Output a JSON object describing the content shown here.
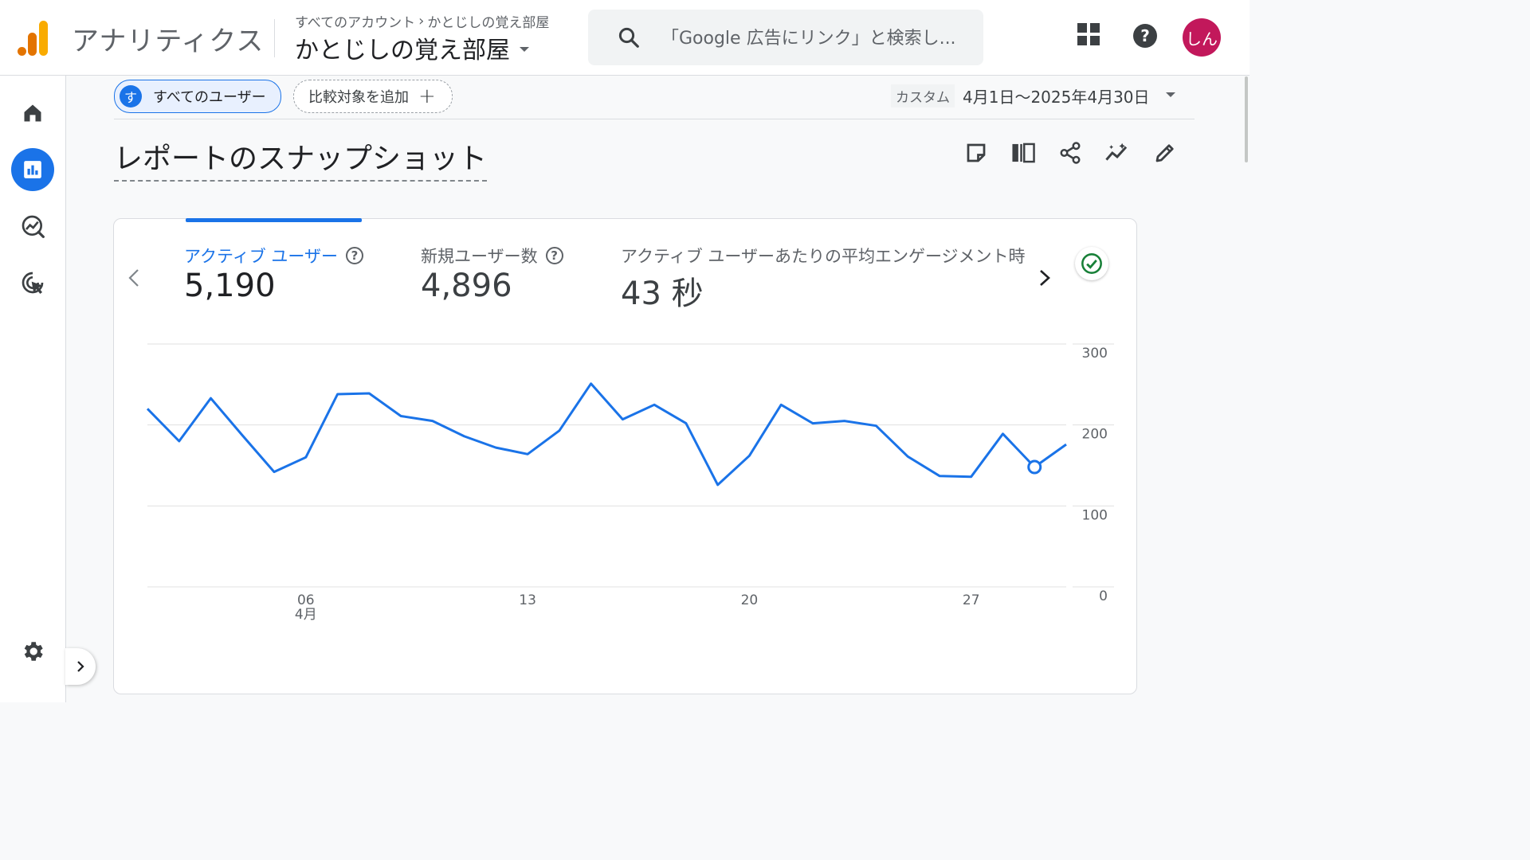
{
  "app": {
    "name": "アナリティクス"
  },
  "header": {
    "breadcrumb_account": "すべてのアカウント",
    "breadcrumb_sep": "›",
    "breadcrumb_property": "かとじしの覚え部屋",
    "property_name": "かとじしの覚え部屋",
    "search_placeholder": "「Google 広告にリンク」と検索し...",
    "avatar_text": "しん"
  },
  "segment": {
    "chip_badge": "す",
    "chip_label": "すべてのユーザー",
    "compare_label": "比較対象を追加",
    "compare_plus": "+"
  },
  "date": {
    "tag": "カスタム",
    "range": "4月1日～2025年4月30日"
  },
  "page": {
    "title": "レポートのスナップショット"
  },
  "metrics": [
    {
      "label": "アクティブ ユーザー",
      "value": "5,190"
    },
    {
      "label": "新規ユーザー数",
      "value": "4,896"
    },
    {
      "label": "アクティブ ユーザーあたりの平均エンゲージメント時",
      "value": "43 秒"
    }
  ],
  "colors": {
    "accent": "#1a73e8",
    "avatar": "#c2185b",
    "success": "#188038"
  },
  "chart_data": {
    "type": "line",
    "series": [
      {
        "x": [
          1,
          2,
          3,
          4,
          5,
          6,
          7,
          8,
          9,
          10,
          11,
          12,
          13,
          14,
          15,
          16,
          17,
          18,
          19,
          20,
          21,
          22,
          23,
          24,
          25,
          26,
          27,
          28,
          29,
          30
        ],
        "values": [
          220,
          180,
          233,
          187,
          142,
          160,
          238,
          239,
          211,
          205,
          186,
          172,
          164,
          193,
          251,
          207,
          225,
          202,
          126,
          162,
          225,
          202,
          205,
          199,
          161,
          137,
          136,
          189,
          148,
          176
        ]
      }
    ],
    "highlight_index": 28,
    "ylim": [
      0,
      300
    ],
    "yticks": [
      0,
      100,
      200,
      300
    ],
    "xticks": [
      {
        "x": 6,
        "label": "06",
        "sub": "4月"
      },
      {
        "x": 13,
        "label": "13",
        "sub": ""
      },
      {
        "x": 20,
        "label": "20",
        "sub": ""
      },
      {
        "x": 27,
        "label": "27",
        "sub": ""
      }
    ],
    "grid": true
  }
}
